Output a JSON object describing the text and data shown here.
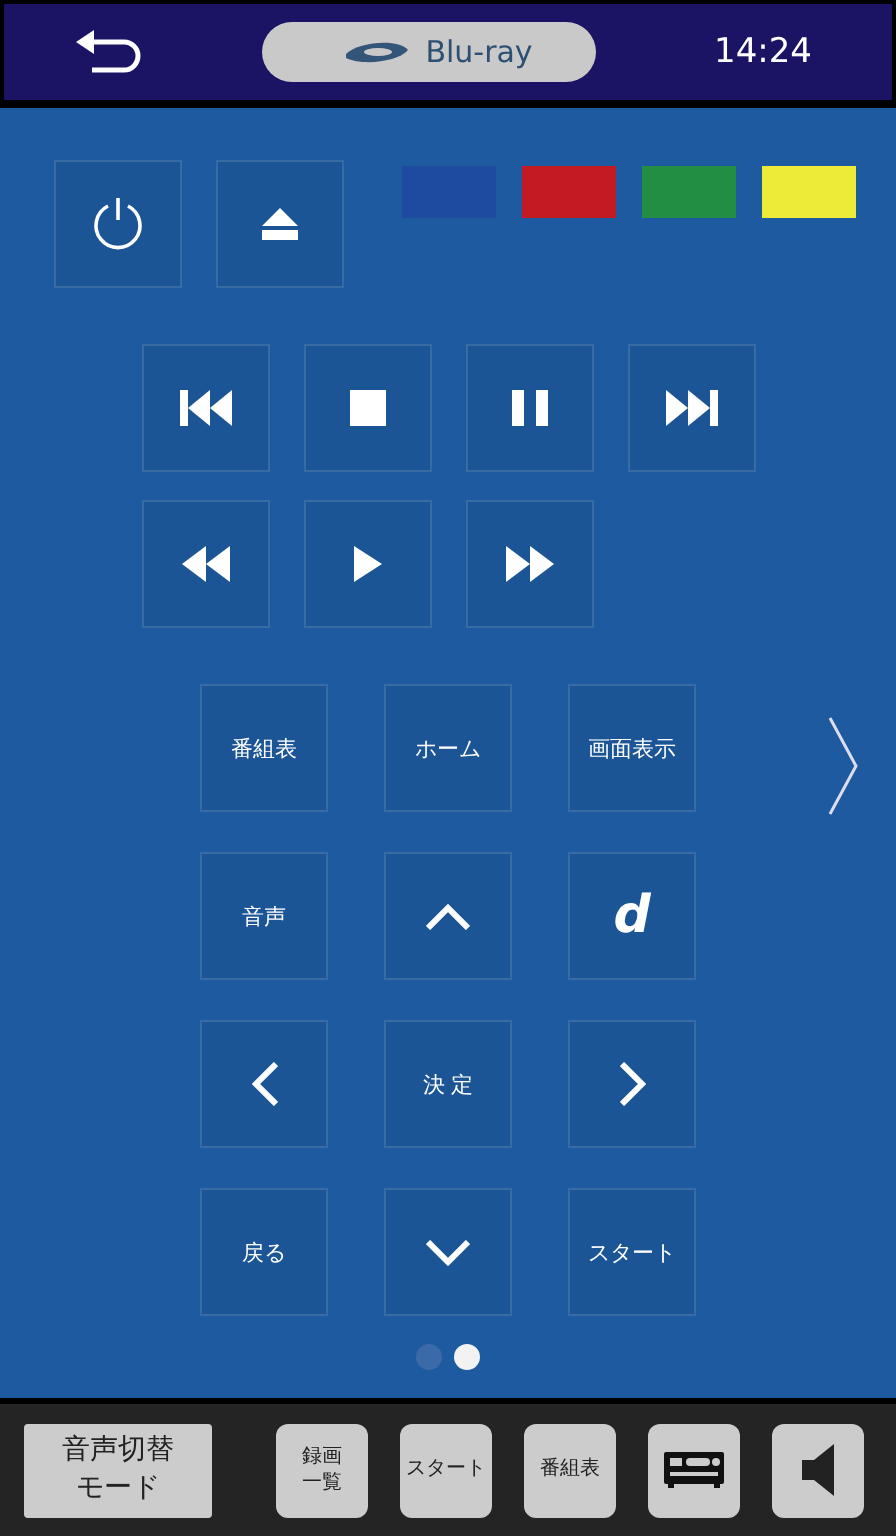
{
  "header": {
    "source": "Blu-ray",
    "time": "14:24"
  },
  "top_buttons": [
    {
      "kind": "power"
    },
    {
      "kind": "eject"
    }
  ],
  "color_buttons": [
    {
      "color": "#1e4aa0"
    },
    {
      "color": "#c41a23"
    },
    {
      "color": "#218e44"
    },
    {
      "color": "#eeeb38"
    }
  ],
  "transport": [
    [
      {
        "kind": "previous"
      },
      {
        "kind": "stop"
      },
      {
        "kind": "pause"
      },
      {
        "kind": "next"
      }
    ],
    [
      {
        "kind": "rewind"
      },
      {
        "kind": "play"
      },
      {
        "kind": "forward"
      }
    ]
  ],
  "pad": [
    {
      "kind": "text",
      "label": "番組表"
    },
    {
      "kind": "text",
      "label": "ホーム"
    },
    {
      "kind": "text",
      "label": "画面表示"
    },
    {
      "kind": "text",
      "label": "音声"
    },
    {
      "kind": "up"
    },
    {
      "kind": "logo",
      "label": "d"
    },
    {
      "kind": "left"
    },
    {
      "kind": "text",
      "label": "決 定"
    },
    {
      "kind": "right"
    },
    {
      "kind": "text",
      "label": "戻る"
    },
    {
      "kind": "down"
    },
    {
      "kind": "text",
      "label": "スタート"
    }
  ],
  "pages": [
    {
      "selected": false
    },
    {
      "selected": true
    }
  ],
  "footer": [
    {
      "kind": "wide",
      "label": "音声切替モード"
    },
    {
      "kind": "stack",
      "label": "録画一覧"
    },
    {
      "kind": "text",
      "label": "スタート"
    },
    {
      "kind": "text",
      "label": "番組表"
    },
    {
      "kind": "receiver"
    },
    {
      "kind": "speaker"
    }
  ]
}
